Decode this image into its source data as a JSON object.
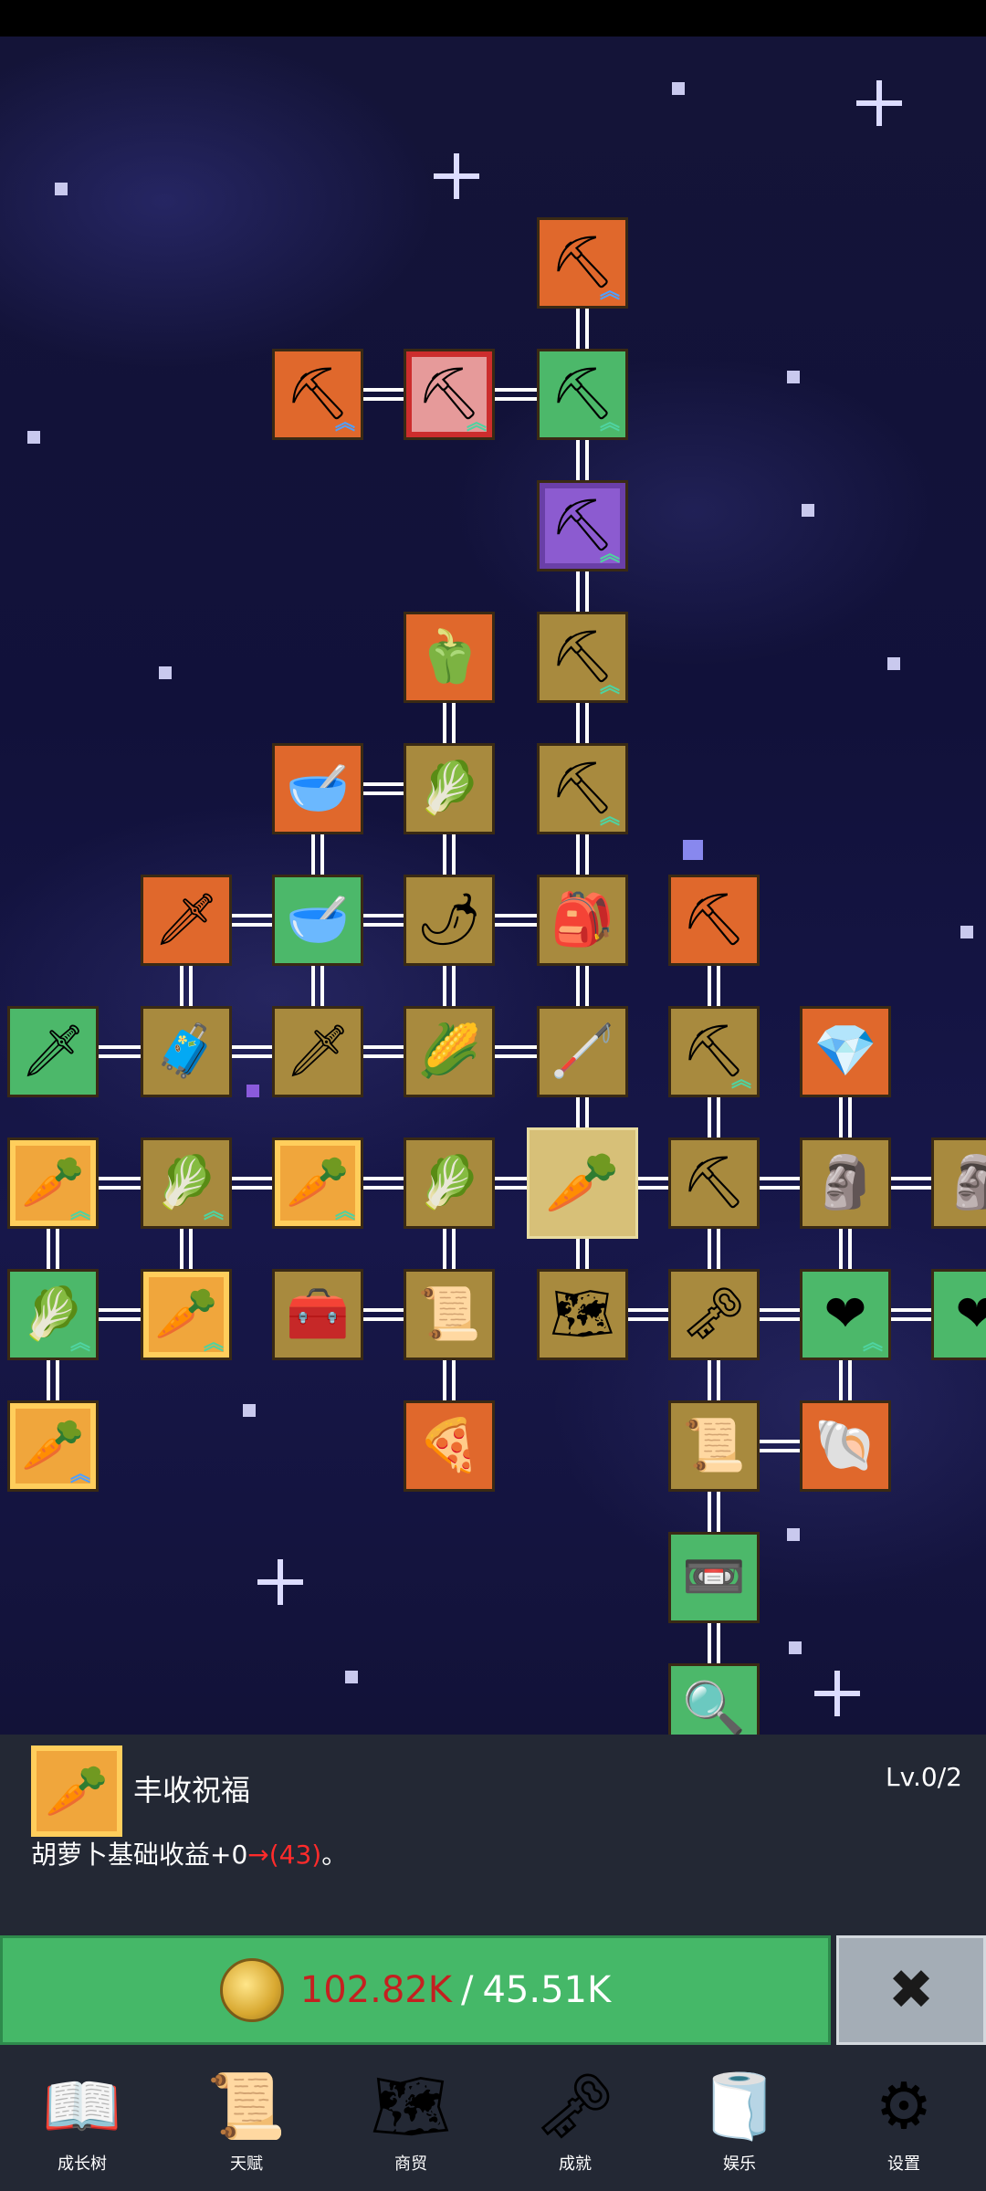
{
  "panel": {
    "icon": "🥕",
    "title": "丰收祝福",
    "level": "Lv.0/2",
    "desc_prefix": "胡萝卜基础收益+0",
    "desc_arrow": "→",
    "desc_value": "(43)",
    "desc_suffix": "。"
  },
  "buy": {
    "cost": "102.82K",
    "separator": "/",
    "have": "45.51K",
    "close_icon": "✖"
  },
  "nav": [
    {
      "label": "成长树",
      "icon": "📖"
    },
    {
      "label": "天赋",
      "icon": "📜"
    },
    {
      "label": "商贸",
      "icon": "🗺"
    },
    {
      "label": "成就",
      "icon": "🗝"
    },
    {
      "label": "娱乐",
      "icon": "🧻"
    },
    {
      "label": "设置",
      "icon": "⚙"
    }
  ],
  "tree_nodes": [
    {
      "id": "n1",
      "icon": "shovel-icon",
      "glyph": "⛏",
      "color": "orange"
    },
    {
      "id": "n2",
      "icon": "shovel-icon",
      "glyph": "⛏",
      "color": "orange"
    },
    {
      "id": "n3",
      "icon": "shovel-icon",
      "glyph": "⛏",
      "color": "pink"
    },
    {
      "id": "n4",
      "icon": "shovel-icon",
      "glyph": "⛏",
      "color": "green"
    },
    {
      "id": "n5",
      "icon": "shovel-icon",
      "glyph": "⛏",
      "color": "purple"
    },
    {
      "id": "n6",
      "icon": "pepper-icon",
      "glyph": "🫑",
      "color": "orange"
    },
    {
      "id": "n7",
      "icon": "shovel-icon",
      "glyph": "⛏",
      "color": "gold"
    },
    {
      "id": "n8",
      "icon": "bowl-icon",
      "glyph": "🥣",
      "color": "orange"
    },
    {
      "id": "n9",
      "icon": "radish-icon",
      "glyph": "🥬",
      "color": "gold"
    },
    {
      "id": "n10",
      "icon": "shovel-icon",
      "glyph": "⛏",
      "color": "gold"
    },
    {
      "id": "n11",
      "icon": "sword-icon",
      "glyph": "🗡",
      "color": "orange"
    },
    {
      "id": "n12",
      "icon": "bowl-icon",
      "glyph": "🥣",
      "color": "green"
    },
    {
      "id": "n13",
      "icon": "chili-icon",
      "glyph": "🌶",
      "color": "gold"
    },
    {
      "id": "n14",
      "icon": "backpack-icon",
      "glyph": "🎒",
      "color": "gold"
    },
    {
      "id": "n15",
      "icon": "pickaxe-icon",
      "glyph": "⛏",
      "color": "orange"
    },
    {
      "id": "n16",
      "icon": "sword-icon",
      "glyph": "🗡",
      "color": "green"
    },
    {
      "id": "n17",
      "icon": "chest-icon",
      "glyph": "🧳",
      "color": "gold"
    },
    {
      "id": "n18",
      "icon": "sword-icon",
      "glyph": "🗡",
      "color": "gold"
    },
    {
      "id": "n19",
      "icon": "corn-icon",
      "glyph": "🌽",
      "color": "gold"
    },
    {
      "id": "n20",
      "icon": "stick-icon",
      "glyph": "🦯",
      "color": "gold"
    },
    {
      "id": "n21",
      "icon": "pickaxe-icon",
      "glyph": "⛏",
      "color": "gold"
    },
    {
      "id": "n22",
      "icon": "crystal-icon",
      "glyph": "💎",
      "color": "orange"
    },
    {
      "id": "n23",
      "icon": "carrot-icon",
      "glyph": "🥕",
      "color": "hl"
    },
    {
      "id": "n24",
      "icon": "cabbage-icon",
      "glyph": "🥬",
      "color": "gold"
    },
    {
      "id": "n25",
      "icon": "carrot-icon",
      "glyph": "🥕",
      "color": "hl"
    },
    {
      "id": "n26",
      "icon": "cabbage-icon",
      "glyph": "🥬",
      "color": "gold"
    },
    {
      "id": "n27",
      "icon": "carrot-icon",
      "glyph": "🥕",
      "color": "selected"
    },
    {
      "id": "n28",
      "icon": "pickaxe-icon",
      "glyph": "⛏",
      "color": "gold"
    },
    {
      "id": "n29",
      "icon": "statue-icon",
      "glyph": "🗿",
      "color": "gold"
    },
    {
      "id": "n30",
      "icon": "statue-icon",
      "glyph": "🗿",
      "color": "gold"
    },
    {
      "id": "n31",
      "icon": "cabbage-icon",
      "glyph": "🥬",
      "color": "green"
    },
    {
      "id": "n32",
      "icon": "carrot-icon",
      "glyph": "🥕",
      "color": "hl"
    },
    {
      "id": "n33",
      "icon": "treasure-chest-icon",
      "glyph": "🧰",
      "color": "gold"
    },
    {
      "id": "n34",
      "icon": "scroll-icon",
      "glyph": "📜",
      "color": "gold"
    },
    {
      "id": "n35",
      "icon": "map-icon",
      "glyph": "🗺",
      "color": "gold"
    },
    {
      "id": "n36",
      "icon": "key-icon",
      "glyph": "🗝",
      "color": "gold"
    },
    {
      "id": "n37",
      "icon": "heart-icon",
      "glyph": "❤",
      "color": "green"
    },
    {
      "id": "n38",
      "icon": "heart-icon",
      "glyph": "❤",
      "color": "green"
    },
    {
      "id": "n39",
      "icon": "carrot-icon",
      "glyph": "🥕",
      "color": "hl"
    },
    {
      "id": "n40",
      "icon": "pizza-icon",
      "glyph": "🍕",
      "color": "orange"
    },
    {
      "id": "n41",
      "icon": "scroll-icon",
      "glyph": "📜",
      "color": "gold"
    },
    {
      "id": "n42",
      "icon": "shell-icon",
      "glyph": "🐚",
      "color": "orange"
    },
    {
      "id": "n43",
      "icon": "cassette-icon",
      "glyph": "📼",
      "color": "green"
    },
    {
      "id": "n44",
      "icon": "magnifier-icon",
      "glyph": "🔍",
      "color": "green"
    }
  ]
}
